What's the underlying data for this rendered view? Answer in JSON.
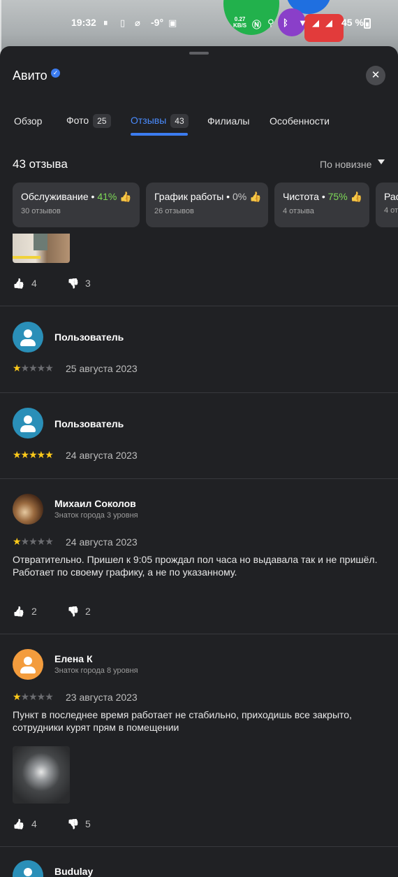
{
  "status_bar": {
    "time": "19:32",
    "temperature": "-9°",
    "net_speed": "0.27",
    "net_unit": "KB/S",
    "battery": "45 %"
  },
  "sheet": {
    "title": "Авито",
    "close_label": "✕"
  },
  "tabs": [
    {
      "label": "Обзор",
      "count": ""
    },
    {
      "label": "Фото",
      "count": "25"
    },
    {
      "label": "Отзывы",
      "count": "43"
    },
    {
      "label": "Филиалы",
      "count": ""
    },
    {
      "label": "Особенности",
      "count": ""
    }
  ],
  "reviews_header": {
    "count_label": "43 отзыва",
    "sort_label": "По новизне"
  },
  "chips": [
    {
      "name": "Обслуживание",
      "percent": "41%",
      "sub": "30 отзывов"
    },
    {
      "name": "График работы",
      "percent": "0%",
      "sub": "26 отзывов"
    },
    {
      "name": "Чистота",
      "percent": "75%",
      "sub": "4 отзыва"
    },
    {
      "name": "Рас",
      "percent": "",
      "sub": "4 от"
    }
  ],
  "reviews": [
    {
      "likes": "4",
      "dislikes": "3"
    },
    {
      "author": "Пользователь",
      "rank": "",
      "rating": 1,
      "date": "25 августа 2023"
    },
    {
      "author": "Пользователь",
      "rank": "",
      "rating": 5,
      "date": "24 августа 2023"
    },
    {
      "author": "Михаил Соколов",
      "rank": "Знаток города 3 уровня",
      "rating": 1,
      "date": "24 августа 2023",
      "text": "Отвратительно. Пришел к 9:05 прождал пол часа но выдавала так и не пришёл. Работает по своему графику, а не по указанному.",
      "likes": "2",
      "dislikes": "2"
    },
    {
      "author": "Елена К",
      "rank": "Знаток города 8 уровня",
      "rating": 1,
      "date": "23 августа 2023",
      "text": "Пункт в последнее время работает не стабильно, приходишь все закрыто, сотрудники курят прям в помещении",
      "likes": "4",
      "dislikes": "5"
    },
    {
      "author": "Budulay"
    }
  ],
  "colors": {
    "background": "#202124",
    "accent": "#3c7cf0",
    "star": "#ffca1a",
    "positive": "#7ed957"
  }
}
